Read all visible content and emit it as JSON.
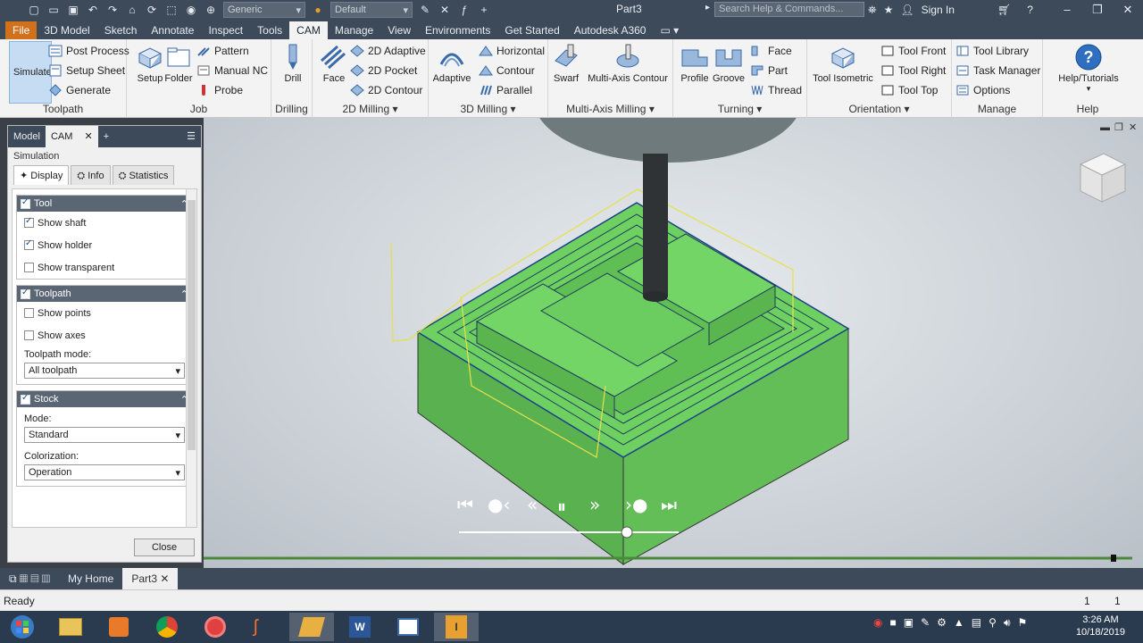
{
  "titlebar": {
    "material": "Generic",
    "appearance": "Default",
    "doc_title": "Part3",
    "search_placeholder": "Search Help & Commands...",
    "sign_in": "Sign In",
    "help_icon": "question-icon"
  },
  "menu": {
    "tabs": [
      "File",
      "3D Model",
      "Sketch",
      "Annotate",
      "Inspect",
      "Tools",
      "CAM",
      "Manage",
      "View",
      "Environments",
      "Get Started",
      "Autodesk A360"
    ],
    "active": "CAM"
  },
  "ribbon": {
    "toolpath": {
      "title": "Toolpath",
      "simulate": "Simulate",
      "post_process": "Post Process",
      "setup_sheet": "Setup Sheet",
      "generate": "Generate"
    },
    "job": {
      "title": "Job",
      "setup": "Setup",
      "folder": "Folder",
      "pattern": "Pattern",
      "manual_nc": "Manual NC",
      "probe": "Probe"
    },
    "drilling": {
      "title": "Drilling",
      "drill": "Drill"
    },
    "milling2d": {
      "title": "2D Milling",
      "face": "Face",
      "adaptive2d": "2D Adaptive",
      "pocket2d": "2D Pocket",
      "contour2d": "2D Contour"
    },
    "milling3d": {
      "title": "3D Milling",
      "adaptive": "Adaptive",
      "horizontal": "Horizontal",
      "contour": "Contour",
      "parallel": "Parallel"
    },
    "multiaxis": {
      "title": "Multi-Axis Milling",
      "swarf": "Swarf",
      "multi_axis_contour": "Multi-Axis Contour"
    },
    "turning": {
      "title": "Turning",
      "profile": "Profile",
      "groove": "Groove",
      "face": "Face",
      "part": "Part",
      "thread": "Thread"
    },
    "orientation": {
      "title": "Orientation",
      "tool_isometric": "Tool Isometric",
      "tool_front": "Tool Front",
      "tool_right": "Tool Right",
      "tool_top": "Tool Top"
    },
    "manage": {
      "title": "Manage",
      "tool_library": "Tool Library",
      "task_manager": "Task Manager",
      "options": "Options"
    },
    "help": {
      "title": "Help",
      "help_tutorials": "Help/Tutorials"
    }
  },
  "browser": {
    "tab_model": "Model",
    "tab_cam": "CAM",
    "add_tab": "+",
    "section": "Simulation",
    "subtabs": [
      "Display",
      "Info",
      "Statistics"
    ],
    "tool_group": {
      "title": "Tool",
      "show_shaft": "Show shaft",
      "show_holder": "Show holder",
      "show_transparent": "Show transparent"
    },
    "toolpath_group": {
      "title": "Toolpath",
      "show_points": "Show points",
      "show_axes": "Show axes",
      "mode_label": "Toolpath mode:",
      "mode_value": "All toolpath"
    },
    "stock_group": {
      "title": "Stock",
      "mode_label": "Mode:",
      "mode_value": "Standard",
      "colorization_label": "Colorization:",
      "colorization_value": "Operation"
    },
    "close": "Close"
  },
  "doc_tabs": [
    "My Home",
    "Part3"
  ],
  "status": {
    "text": "Ready",
    "count1": "1",
    "count2": "1"
  },
  "clock": {
    "time": "3:26 AM",
    "date": "10/18/2019"
  },
  "colors": {
    "ribbon_bg": "#f3f3f3",
    "titlebar": "#3d4a5a",
    "file_tab": "#d1711b",
    "stock_green": "#66c55c",
    "toolpath_yellow": "#e8e04a"
  }
}
